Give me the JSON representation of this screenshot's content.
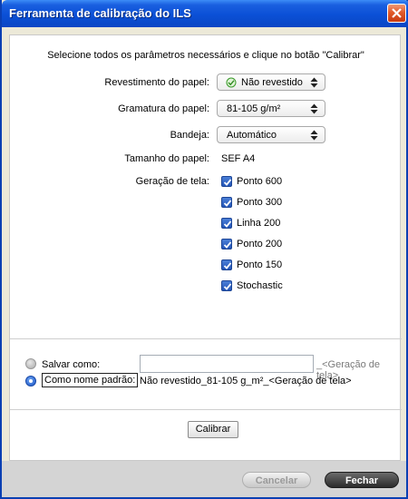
{
  "window": {
    "title": "Ferramenta de calibração do ILS"
  },
  "instruction": "Selecione todos os parâmetros necessários e clique no botão \"Calibrar\"",
  "paper_coating": {
    "label": "Revestimento do papel:",
    "value": "Não revestido",
    "icon": "check-circle-icon"
  },
  "paper_weight": {
    "label": "Gramatura do papel:",
    "value": "81-105 g/m²"
  },
  "tray": {
    "label": "Bandeja:",
    "value": "Automático"
  },
  "paper_size": {
    "label": "Tamanho do papel:",
    "value": "SEF A4"
  },
  "screening": {
    "label": "Geração de tela:",
    "options": [
      {
        "label": "Ponto 600",
        "checked": true
      },
      {
        "label": "Ponto 300",
        "checked": true
      },
      {
        "label": "Linha 200",
        "checked": true
      },
      {
        "label": "Ponto 200",
        "checked": true
      },
      {
        "label": "Ponto 150",
        "checked": true
      },
      {
        "label": "Stochastic",
        "checked": true
      }
    ]
  },
  "save_as": {
    "label": "Salvar como:",
    "value": "",
    "suffix": "_<Geração de tela>",
    "selected": false
  },
  "default_name": {
    "label": "Como nome padrão:",
    "value": "Não revestido_81-105 g_m²_<Geração de tela>",
    "selected": true
  },
  "buttons": {
    "calibrate": "Calibrar",
    "cancel": "Cancelar",
    "close": "Fechar"
  },
  "colors": {
    "titlebar": "#0b50d6",
    "close_button": "#e15b2a",
    "checkbox": "#2456b8",
    "footer": "#d4d4d4"
  }
}
